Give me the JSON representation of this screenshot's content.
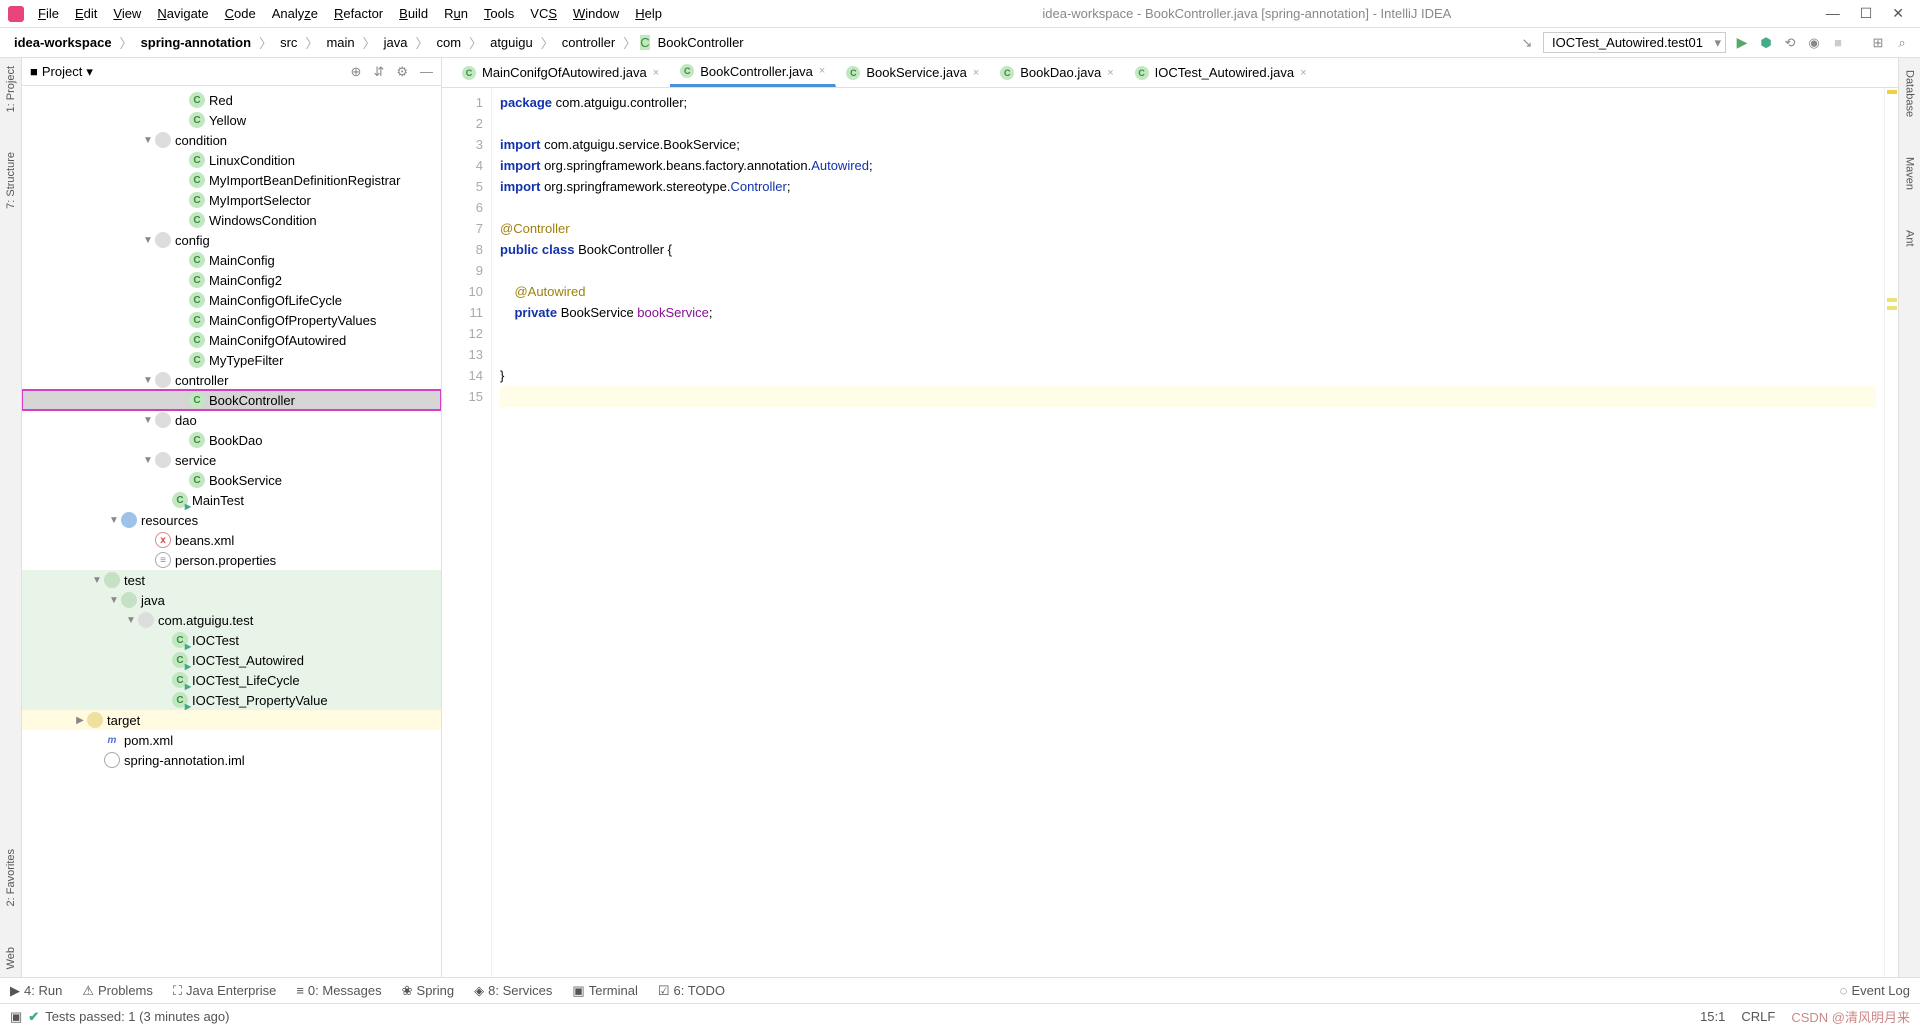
{
  "window": {
    "title": "idea-workspace - BookController.java [spring-annotation] - IntelliJ IDEA"
  },
  "menu": [
    "File",
    "Edit",
    "View",
    "Navigate",
    "Code",
    "Analyze",
    "Refactor",
    "Build",
    "Run",
    "Tools",
    "VCS",
    "Window",
    "Help"
  ],
  "breadcrumb": [
    "idea-workspace",
    "spring-annotation",
    "src",
    "main",
    "java",
    "com",
    "atguigu",
    "controller",
    "BookController"
  ],
  "run_config": "IOCTest_Autowired.test01",
  "left_tools": [
    "1: Project",
    "7: Structure",
    "2: Favorites",
    "Web"
  ],
  "right_tools": [
    "Database",
    "Maven",
    "Ant"
  ],
  "panel_title": "Project",
  "tree": [
    {
      "l": 9,
      "t": "c",
      "n": "Red"
    },
    {
      "l": 9,
      "t": "c",
      "n": "Yellow"
    },
    {
      "l": 7,
      "t": "fold",
      "n": "condition",
      "open": true
    },
    {
      "l": 9,
      "t": "c",
      "n": "LinuxCondition"
    },
    {
      "l": 9,
      "t": "c",
      "n": "MyImportBeanDefinitionRegistrar"
    },
    {
      "l": 9,
      "t": "c",
      "n": "MyImportSelector"
    },
    {
      "l": 9,
      "t": "c",
      "n": "WindowsCondition"
    },
    {
      "l": 7,
      "t": "fold",
      "n": "config",
      "open": true
    },
    {
      "l": 9,
      "t": "c",
      "n": "MainConfig"
    },
    {
      "l": 9,
      "t": "c",
      "n": "MainConfig2"
    },
    {
      "l": 9,
      "t": "c",
      "n": "MainConfigOfLifeCycle"
    },
    {
      "l": 9,
      "t": "c",
      "n": "MainConfigOfPropertyValues"
    },
    {
      "l": 9,
      "t": "c",
      "n": "MainConifgOfAutowired"
    },
    {
      "l": 9,
      "t": "c",
      "n": "MyTypeFilter"
    },
    {
      "l": 7,
      "t": "fold",
      "n": "controller",
      "open": true
    },
    {
      "l": 9,
      "t": "c",
      "n": "BookController",
      "sel": true,
      "box": true
    },
    {
      "l": 7,
      "t": "fold",
      "n": "dao",
      "open": true
    },
    {
      "l": 9,
      "t": "c",
      "n": "BookDao"
    },
    {
      "l": 7,
      "t": "fold",
      "n": "service",
      "open": true
    },
    {
      "l": 9,
      "t": "c",
      "n": "BookService"
    },
    {
      "l": 8,
      "t": "cr",
      "n": "MainTest"
    },
    {
      "l": 5,
      "t": "foldb",
      "n": "resources",
      "open": true
    },
    {
      "l": 7,
      "t": "xml",
      "n": "beans.xml"
    },
    {
      "l": 7,
      "t": "prop",
      "n": "person.properties"
    },
    {
      "l": 4,
      "t": "foldg",
      "n": "test",
      "open": true,
      "bg": "g"
    },
    {
      "l": 5,
      "t": "foldg",
      "n": "java",
      "open": true,
      "bg": "g"
    },
    {
      "l": 6,
      "t": "fold",
      "n": "com.atguigu.test",
      "open": true,
      "bg": "g"
    },
    {
      "l": 8,
      "t": "cr",
      "n": "IOCTest",
      "bg": "g"
    },
    {
      "l": 8,
      "t": "cr",
      "n": "IOCTest_Autowired",
      "bg": "g"
    },
    {
      "l": 8,
      "t": "cr",
      "n": "IOCTest_LifeCycle",
      "bg": "g"
    },
    {
      "l": 8,
      "t": "cr",
      "n": "IOCTest_PropertyValue",
      "bg": "g"
    },
    {
      "l": 3,
      "t": "foldy",
      "n": "target",
      "open": false,
      "bg": "y"
    },
    {
      "l": 4,
      "t": "mvn",
      "n": "pom.xml"
    },
    {
      "l": 4,
      "t": "ij",
      "n": "spring-annotation.iml"
    }
  ],
  "tabs": [
    {
      "n": "MainConifgOfAutowired.java"
    },
    {
      "n": "BookController.java",
      "active": true
    },
    {
      "n": "BookService.java"
    },
    {
      "n": "BookDao.java"
    },
    {
      "n": "IOCTest_Autowired.java"
    }
  ],
  "code": {
    "lines": 15,
    "l1": {
      "kw": "package",
      "rest": " com.atguigu.controller;"
    },
    "l3": {
      "kw": "import",
      "rest": " com.atguigu.service.BookService;"
    },
    "l4": {
      "kw": "import",
      "pre": " org.springframework.beans.factory.annotation.",
      "cls": "Autowired",
      "post": ";"
    },
    "l5": {
      "kw": "import",
      "pre": " org.springframework.stereotype.",
      "cls": "Controller",
      "post": ";"
    },
    "l7": {
      "ann": "@Controller"
    },
    "l8": {
      "kw1": "public",
      "kw2": "class",
      "name": "BookController",
      "brace": " {"
    },
    "l10": {
      "ann": "@Autowired"
    },
    "l11": {
      "kw": "private",
      "type": "BookService",
      "field": "bookService",
      "post": ";"
    },
    "l14": {
      "txt": "}"
    }
  },
  "bottom_tools": [
    "4: Run",
    "Problems",
    "Java Enterprise",
    "0: Messages",
    "Spring",
    "8: Services",
    "Terminal",
    "6: TODO"
  ],
  "event_log": "Event Log",
  "status": {
    "msg": "Tests passed: 1 (3 minutes ago)",
    "pos": "15:1",
    "enc": "CRLF",
    "watermark": "CSDN @清风明月来"
  }
}
